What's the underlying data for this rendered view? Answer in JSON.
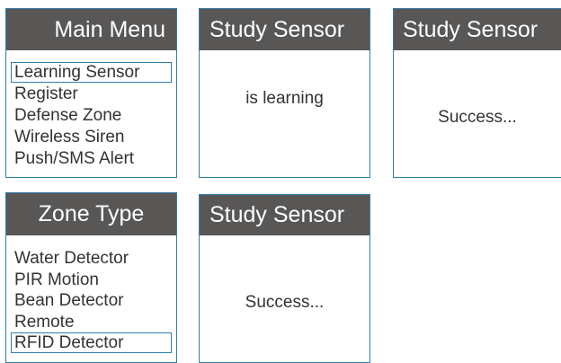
{
  "main_menu": {
    "title": "Main Menu",
    "items": [
      {
        "label": "Learning Sensor"
      },
      {
        "label": "Register"
      },
      {
        "label": "Defense Zone"
      },
      {
        "label": "Wireless Siren"
      },
      {
        "label": "Push/SMS Alert"
      }
    ]
  },
  "study_sensor_learning": {
    "title": "Study Sensor",
    "message": "is learning"
  },
  "study_sensor_success_1": {
    "title": "Study Sensor",
    "message": "Success..."
  },
  "zone_type": {
    "title": "Zone Type",
    "items": [
      {
        "label": "Water Detector"
      },
      {
        "label": "PIR Motion"
      },
      {
        "label": "Bean Detector"
      },
      {
        "label": "Remote"
      },
      {
        "label": "RFID Detector"
      }
    ]
  },
  "study_sensor_success_2": {
    "title": "Study Sensor",
    "message": "Success..."
  },
  "colors": {
    "header_bg": "#595656",
    "border": "#2f7fa8",
    "text": "#333333"
  }
}
